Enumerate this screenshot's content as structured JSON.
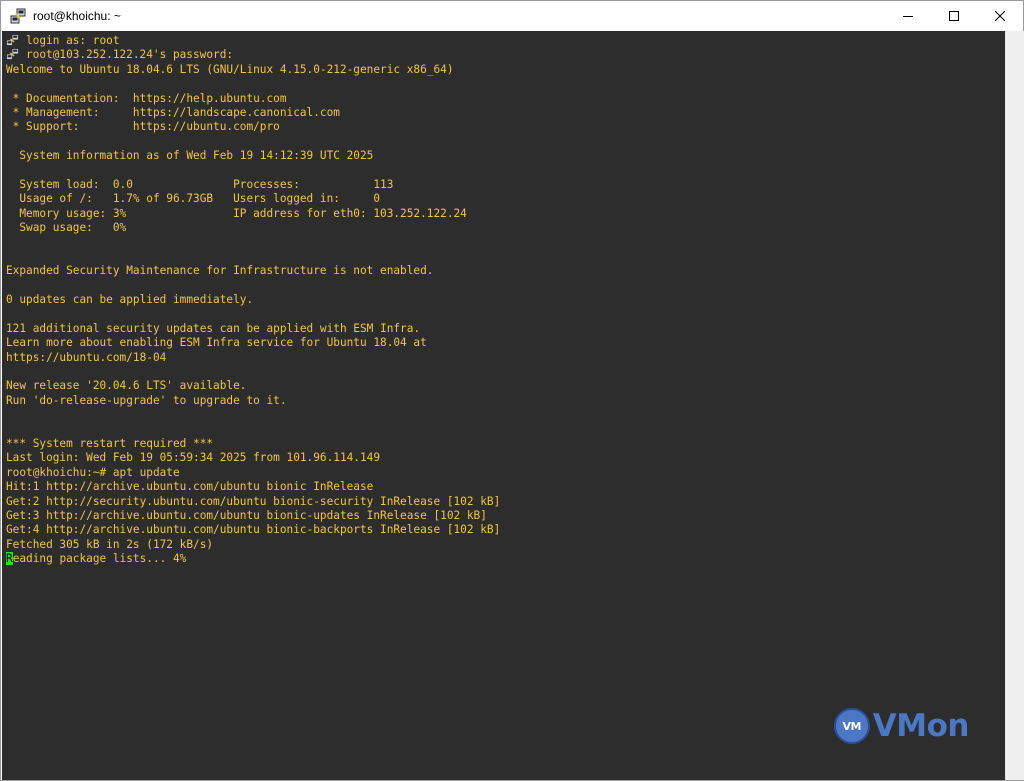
{
  "window": {
    "title": "root@khoichu: ~",
    "app_icon": "putty-icon",
    "controls": {
      "minimize_icon": "minimize-icon",
      "maximize_icon": "maximize-icon",
      "close_icon": "close-icon"
    }
  },
  "terminal": {
    "background": "#2d2d2d",
    "text_color": "#f2c641",
    "cursor_color": "#22e022",
    "lines": [
      {
        "text": "login as: root",
        "icon": "putty-icon"
      },
      {
        "text": "root@103.252.122.24's password:",
        "icon": "putty-icon"
      },
      {
        "text": "Welcome to Ubuntu 18.04.6 LTS (GNU/Linux 4.15.0-212-generic x86_64)"
      },
      {
        "text": ""
      },
      {
        "text": " * Documentation:  https://help.ubuntu.com"
      },
      {
        "text": " * Management:     https://landscape.canonical.com"
      },
      {
        "text": " * Support:        https://ubuntu.com/pro"
      },
      {
        "text": ""
      },
      {
        "text": "  System information as of Wed Feb 19 14:12:39 UTC 2025"
      },
      {
        "text": ""
      },
      {
        "text": "  System load:  0.0               Processes:           113"
      },
      {
        "text": "  Usage of /:   1.7% of 96.73GB   Users logged in:     0"
      },
      {
        "text": "  Memory usage: 3%                IP address for eth0: 103.252.122.24"
      },
      {
        "text": "  Swap usage:   0%"
      },
      {
        "text": ""
      },
      {
        "text": ""
      },
      {
        "text": "Expanded Security Maintenance for Infrastructure is not enabled."
      },
      {
        "text": ""
      },
      {
        "text": "0 updates can be applied immediately."
      },
      {
        "text": ""
      },
      {
        "text": "121 additional security updates can be applied with ESM Infra."
      },
      {
        "text": "Learn more about enabling ESM Infra service for Ubuntu 18.04 at"
      },
      {
        "text": "https://ubuntu.com/18-04"
      },
      {
        "text": ""
      },
      {
        "text": "New release '20.04.6 LTS' available."
      },
      {
        "text": "Run 'do-release-upgrade' to upgrade to it."
      },
      {
        "text": ""
      },
      {
        "text": ""
      },
      {
        "text": "*** System restart required ***"
      },
      {
        "text": "Last login: Wed Feb 19 05:59:34 2025 from 101.96.114.149"
      },
      {
        "text": "root@khoichu:~# apt update"
      },
      {
        "text": "Hit:1 http://archive.ubuntu.com/ubuntu bionic InRelease"
      },
      {
        "text": "Get:2 http://security.ubuntu.com/ubuntu bionic-security InRelease [102 kB]"
      },
      {
        "text": "Get:3 http://archive.ubuntu.com/ubuntu bionic-updates InRelease [102 kB]"
      },
      {
        "text": "Get:4 http://archive.ubuntu.com/ubuntu bionic-backports InRelease [102 kB]"
      },
      {
        "text": "Fetched 305 kB in 2s (172 kB/s)"
      },
      {
        "cursor_char": "R",
        "text": "eading package lists... 4%"
      }
    ]
  },
  "watermark": {
    "badge": "VM",
    "text": "VMon",
    "color": "#4b77c4"
  }
}
